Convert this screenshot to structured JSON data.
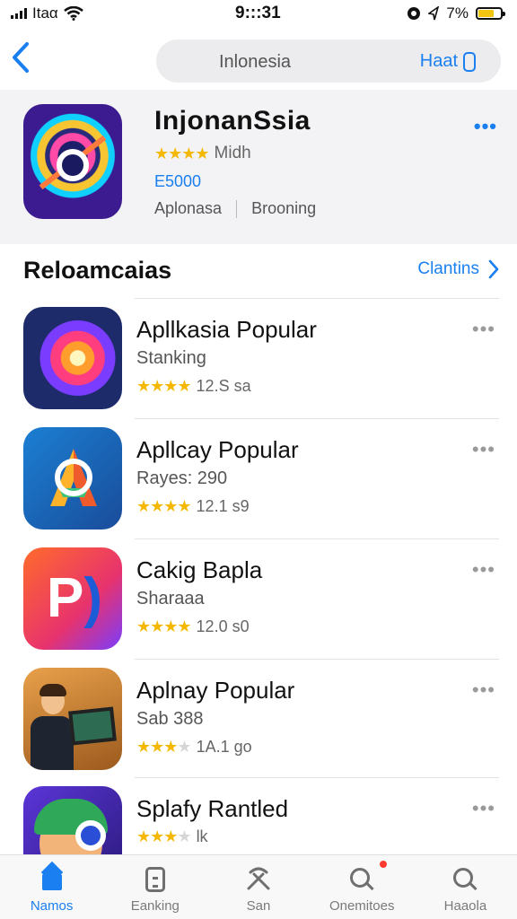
{
  "status_bar": {
    "carrier": "Itaα",
    "time": "9:::31",
    "battery": "7%",
    "battery_level": 0.7
  },
  "header": {
    "search_query": "Inlonesia",
    "action_label": "Haat"
  },
  "featured": {
    "title": "InjonanSsia",
    "stars": "★★★★",
    "rating_label": "Midh",
    "price": "E5000",
    "category": "Aplonasa",
    "tag": "Brooning"
  },
  "section": {
    "title": "Reloamcaias",
    "link_label": "Clantins"
  },
  "apps": [
    {
      "name": "Apllkasia Popular",
      "subtitle": "Stanking",
      "stars_full": "★★★★",
      "stars_dim": "",
      "rating_text": "12.S sa"
    },
    {
      "name": "Apllcay Popular",
      "subtitle": "Rayes: 290",
      "stars_full": "★★★★",
      "stars_dim": "",
      "rating_text": "12.1 s9"
    },
    {
      "name": "Cakig Bapla",
      "subtitle": "Sharaaa",
      "stars_full": "★★★★",
      "stars_dim": "",
      "rating_text": "12.0 s0"
    },
    {
      "name": "Aplnay Popular",
      "subtitle": "Sab 388",
      "stars_full": "★★★",
      "stars_dim": "★",
      "rating_text": "1A.1 go"
    },
    {
      "name": "Splafy Rantled",
      "subtitle": "",
      "stars_full": "★★★",
      "stars_dim": "★",
      "rating_text": "lk"
    }
  ],
  "tabs": [
    {
      "label": "Namos",
      "icon": "home-icon",
      "active": true
    },
    {
      "label": "Eanking",
      "icon": "list-icon",
      "active": false
    },
    {
      "label": "San",
      "icon": "tools-icon",
      "active": false
    },
    {
      "label": "Onemitoes",
      "icon": "search-icon",
      "active": false
    },
    {
      "label": "Haaola",
      "icon": "search-icon",
      "active": false
    }
  ],
  "colors": {
    "accent": "#1a7ff0",
    "star": "#f5b800",
    "featured_bg": "#f3f3f5"
  }
}
